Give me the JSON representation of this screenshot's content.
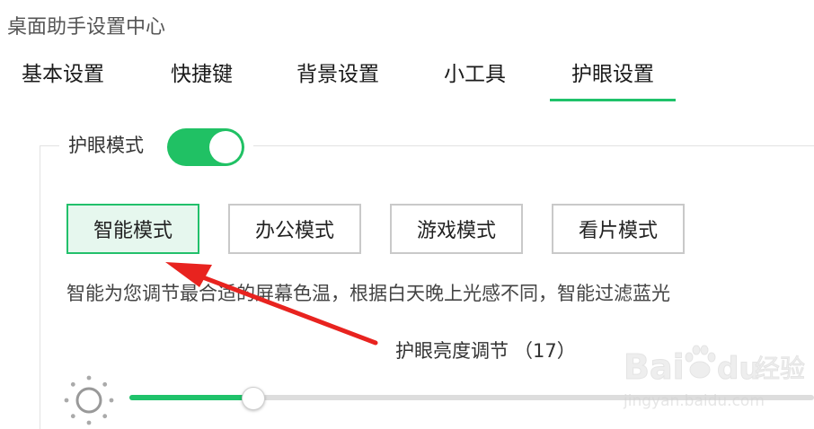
{
  "window": {
    "title": "桌面助手设置中心"
  },
  "tabs": [
    {
      "label": "基本设置",
      "active": false
    },
    {
      "label": "快捷键",
      "active": false
    },
    {
      "label": "背景设置",
      "active": false
    },
    {
      "label": "小工具",
      "active": false
    },
    {
      "label": "护眼设置",
      "active": true
    }
  ],
  "eye_mode": {
    "label": "护眼模式",
    "enabled": true
  },
  "modes": [
    {
      "label": "智能模式",
      "selected": true
    },
    {
      "label": "办公模式",
      "selected": false
    },
    {
      "label": "游戏模式",
      "selected": false
    },
    {
      "label": "看片模式",
      "selected": false
    }
  ],
  "description": "智能为您调节最合适的屏幕色温，根据白天晚上光感不同，智能过滤蓝光",
  "brightness": {
    "label": "护眼亮度调节",
    "value_text": "（17）",
    "fraction": 0.18
  },
  "colors": {
    "accent": "#1fc26a",
    "toggle": "#20c164",
    "selected_bg": "#e6f7ee",
    "arrow": "#e8231f"
  },
  "icons": {
    "brightness": "sun-icon"
  },
  "watermark": {
    "brand": "Bai",
    "brand_suffix": "du",
    "product": "经验",
    "url": "jingyan.baidu.com"
  }
}
